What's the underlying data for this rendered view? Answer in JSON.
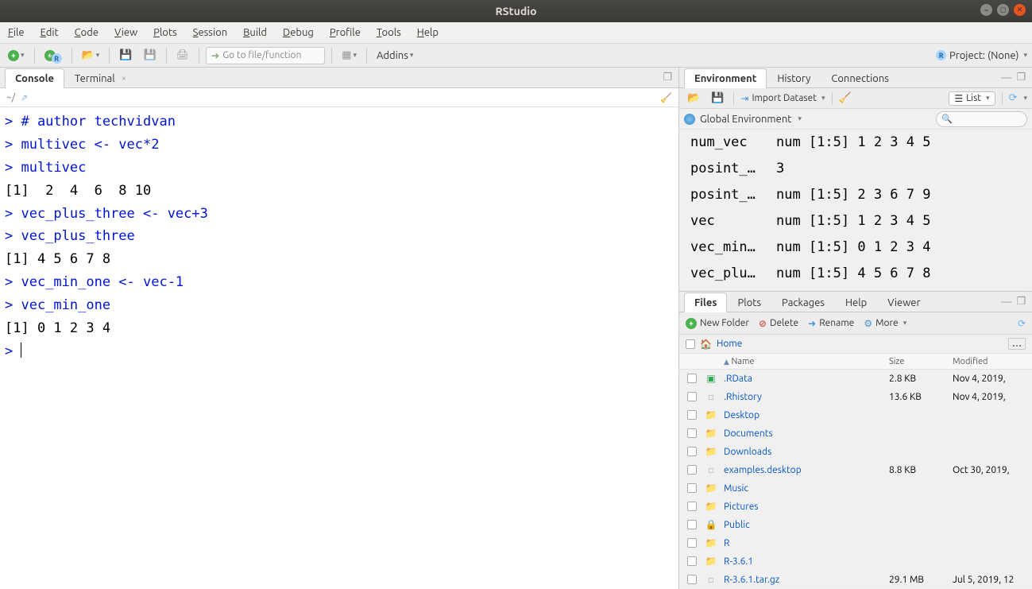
{
  "window": {
    "title": "RStudio"
  },
  "menubar": [
    "File",
    "Edit",
    "Code",
    "View",
    "Plots",
    "Session",
    "Build",
    "Debug",
    "Profile",
    "Tools",
    "Help"
  ],
  "toolbar": {
    "goto_placeholder": "Go to file/function",
    "addins_label": "Addins",
    "project_label": "Project: (None)"
  },
  "left": {
    "tabs": {
      "console": "Console",
      "terminal": "Terminal"
    },
    "path": "~/",
    "console_lines": [
      {
        "t": "inp",
        "s": "> # author techvidvan"
      },
      {
        "t": "inp",
        "s": "> multivec <- vec*2"
      },
      {
        "t": "inp",
        "s": "> multivec"
      },
      {
        "t": "out",
        "s": "[1]  2  4  6  8 10"
      },
      {
        "t": "inp",
        "s": "> vec_plus_three <- vec+3"
      },
      {
        "t": "inp",
        "s": "> vec_plus_three"
      },
      {
        "t": "out",
        "s": "[1] 4 5 6 7 8"
      },
      {
        "t": "inp",
        "s": "> vec_min_one <- vec-1"
      },
      {
        "t": "inp",
        "s": "> vec_min_one"
      },
      {
        "t": "out",
        "s": "[1] 0 1 2 3 4"
      },
      {
        "t": "inp",
        "s": "> "
      }
    ]
  },
  "env": {
    "tabs": {
      "environment": "Environment",
      "history": "History",
      "connections": "Connections"
    },
    "import_label": "Import Dataset",
    "list_label": "List",
    "scope_label": "Global Environment",
    "vars": [
      {
        "name": "num_vec",
        "value": "num [1:5] 1 2 3 4 5"
      },
      {
        "name": "posint_…",
        "value": "3"
      },
      {
        "name": "posint_…",
        "value": "num [1:5] 2 3 6 7 9"
      },
      {
        "name": "vec",
        "value": "num [1:5] 1 2 3 4 5"
      },
      {
        "name": "vec_min…",
        "value": "num [1:5] 0 1 2 3 4"
      },
      {
        "name": "vec_plu…",
        "value": "num [1:5] 4 5 6 7 8"
      }
    ]
  },
  "files": {
    "tabs": {
      "files": "Files",
      "plots": "Plots",
      "packages": "Packages",
      "help": "Help",
      "viewer": "Viewer"
    },
    "toolbar": {
      "new_folder": "New Folder",
      "delete": "Delete",
      "rename": "Rename",
      "more": "More"
    },
    "breadcrumb_home": "Home",
    "headers": {
      "name": "Name",
      "size": "Size",
      "modified": "Modified",
      "name_arrow": "▲"
    },
    "rows": [
      {
        "icon": "rdata",
        "name": ".RData",
        "size": "2.8 KB",
        "mod": "Nov 4, 2019,"
      },
      {
        "icon": "file",
        "name": ".Rhistory",
        "size": "13.6 KB",
        "mod": "Nov 4, 2019,"
      },
      {
        "icon": "folder",
        "name": "Desktop",
        "size": "",
        "mod": ""
      },
      {
        "icon": "folder",
        "name": "Documents",
        "size": "",
        "mod": ""
      },
      {
        "icon": "folder",
        "name": "Downloads",
        "size": "",
        "mod": ""
      },
      {
        "icon": "file",
        "name": "examples.desktop",
        "size": "8.8 KB",
        "mod": "Oct 30, 2019,"
      },
      {
        "icon": "folder",
        "name": "Music",
        "size": "",
        "mod": ""
      },
      {
        "icon": "folder",
        "name": "Pictures",
        "size": "",
        "mod": ""
      },
      {
        "icon": "lock",
        "name": "Public",
        "size": "",
        "mod": ""
      },
      {
        "icon": "folder",
        "name": "R",
        "size": "",
        "mod": ""
      },
      {
        "icon": "folder",
        "name": "R-3.6.1",
        "size": "",
        "mod": ""
      },
      {
        "icon": "file",
        "name": "R-3.6.1.tar.gz",
        "size": "29.1 MB",
        "mod": "Jul 5, 2019, 12"
      }
    ]
  }
}
